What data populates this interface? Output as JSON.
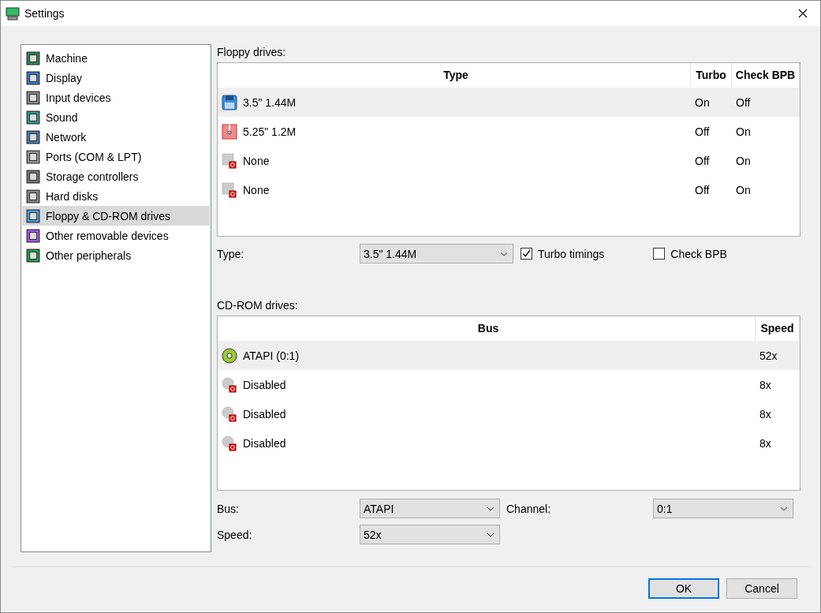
{
  "window": {
    "title": "Settings"
  },
  "sidebar": {
    "items": [
      {
        "label": "Machine",
        "selected": false
      },
      {
        "label": "Display",
        "selected": false
      },
      {
        "label": "Input devices",
        "selected": false
      },
      {
        "label": "Sound",
        "selected": false
      },
      {
        "label": "Network",
        "selected": false
      },
      {
        "label": "Ports (COM & LPT)",
        "selected": false
      },
      {
        "label": "Storage controllers",
        "selected": false
      },
      {
        "label": "Hard disks",
        "selected": false
      },
      {
        "label": "Floppy & CD-ROM drives",
        "selected": true
      },
      {
        "label": "Other removable devices",
        "selected": false
      },
      {
        "label": "Other peripherals",
        "selected": false
      }
    ]
  },
  "floppy": {
    "label": "Floppy drives:",
    "columns": [
      "Type",
      "Turbo",
      "Check BPB"
    ],
    "rows": [
      {
        "kind": "floppy35",
        "type": "3.5\" 1.44M",
        "turbo": "On",
        "check_bpb": "Off",
        "selected": true
      },
      {
        "kind": "floppy525",
        "type": "5.25\" 1.2M",
        "turbo": "Off",
        "check_bpb": "On",
        "selected": false
      },
      {
        "kind": "none",
        "type": "None",
        "turbo": "Off",
        "check_bpb": "On",
        "selected": false
      },
      {
        "kind": "none",
        "type": "None",
        "turbo": "Off",
        "check_bpb": "On",
        "selected": false
      }
    ],
    "type_label": "Type:",
    "type_value": "3.5\" 1.44M",
    "turbo": {
      "label": "Turbo timings",
      "checked": true
    },
    "check_bpb": {
      "label": "Check BPB",
      "checked": false
    }
  },
  "cdrom": {
    "label": "CD-ROM drives:",
    "columns": [
      "Bus",
      "Speed"
    ],
    "rows": [
      {
        "kind": "cd",
        "bus": "ATAPI (0:1)",
        "speed": "52x",
        "selected": true
      },
      {
        "kind": "disabled",
        "bus": "Disabled",
        "speed": "8x",
        "selected": false
      },
      {
        "kind": "disabled",
        "bus": "Disabled",
        "speed": "8x",
        "selected": false
      },
      {
        "kind": "disabled",
        "bus": "Disabled",
        "speed": "8x",
        "selected": false
      }
    ],
    "bus_label": "Bus:",
    "bus_value": "ATAPI",
    "channel_label": "Channel:",
    "channel_value": "0:1",
    "speed_label": "Speed:",
    "speed_value": "52x"
  },
  "buttons": [
    "OK",
    "Cancel"
  ]
}
